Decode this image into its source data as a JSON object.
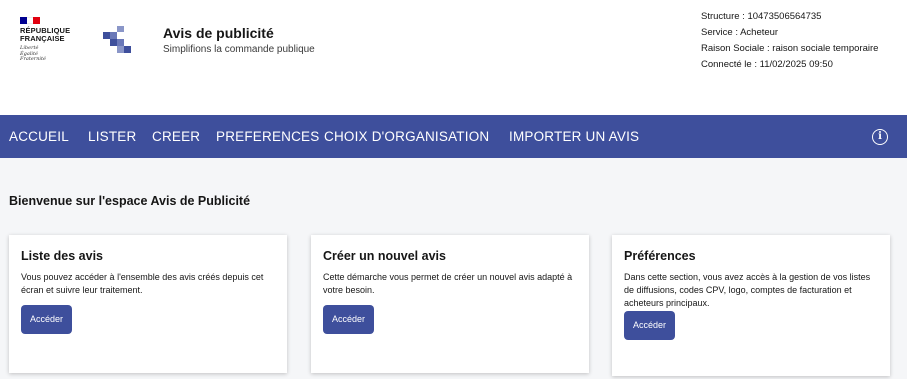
{
  "header": {
    "republic_line1": "RÉPUBLIQUE",
    "republic_line2": "FRANÇAISE",
    "motto": [
      "Liberté",
      "Égalité",
      "Fraternité"
    ],
    "flag_colors": [
      "#000091",
      "#ffffff",
      "#e1000f"
    ],
    "title": "Avis de publicité",
    "subtitle": "Simplifions la commande publique"
  },
  "user_info": {
    "structure": "Structure : 10473506564735",
    "service": "Service : Acheteur",
    "raison_sociale": "Raison Sociale : raison sociale temporaire",
    "connecte": "Connecté le : 11/02/2025 09:50"
  },
  "nav": {
    "items": [
      "ACCUEIL",
      "LISTER",
      "CREER",
      "PREFERENCES",
      "CHOIX D'ORGANISATION",
      "IMPORTER UN AVIS"
    ],
    "info_icon": "info-icon",
    "bg_color": "#3e4f9c"
  },
  "main": {
    "welcome": "Bienvenue sur l'espace Avis de Publicité",
    "cards": [
      {
        "title": "Liste des avis",
        "text": "Vous pouvez accéder à l'ensemble des avis créés depuis cet écran et suivre leur traitement.",
        "button": "Accéder"
      },
      {
        "title": "Créer un nouvel avis",
        "text": "Cette démarche vous permet de créer un nouvel avis adapté à votre besoin.",
        "button": "Accéder"
      },
      {
        "title": "Préférences",
        "text": "Dans cette section, vous avez accès à la gestion de vos listes de diffusions, codes CPV, logo, comptes de facturation et acheteurs principaux.",
        "button": "Accéder"
      }
    ]
  }
}
